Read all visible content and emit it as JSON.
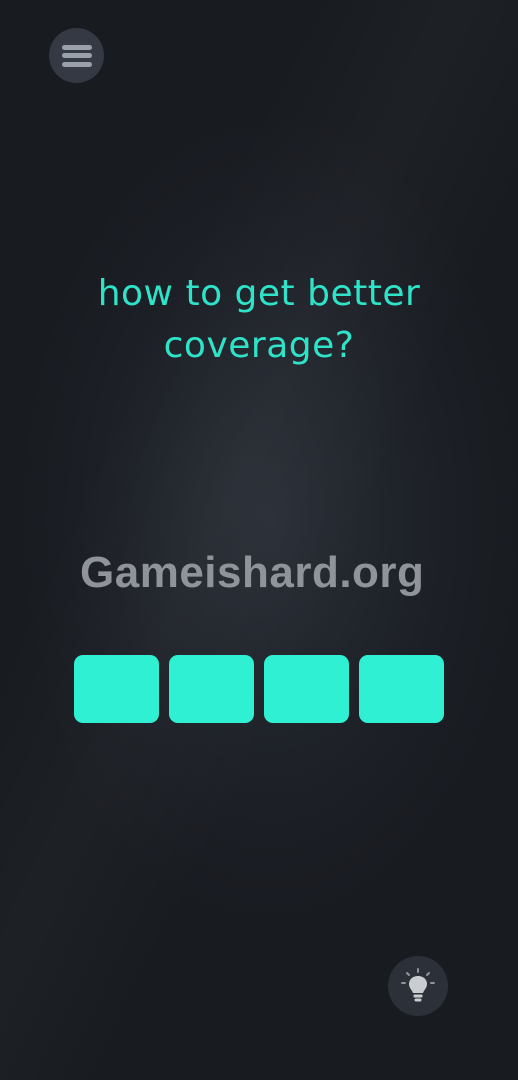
{
  "header": {
    "menu_icon": "hamburger-menu-icon"
  },
  "puzzle": {
    "question": "how to get better coverage?",
    "answer_tile_count": 4,
    "tile_color": "#2ff0d3",
    "text_color": "#2fe3c9"
  },
  "watermark": {
    "text": "Gameishard.org"
  },
  "footer": {
    "hint_icon": "lightbulb-icon"
  }
}
